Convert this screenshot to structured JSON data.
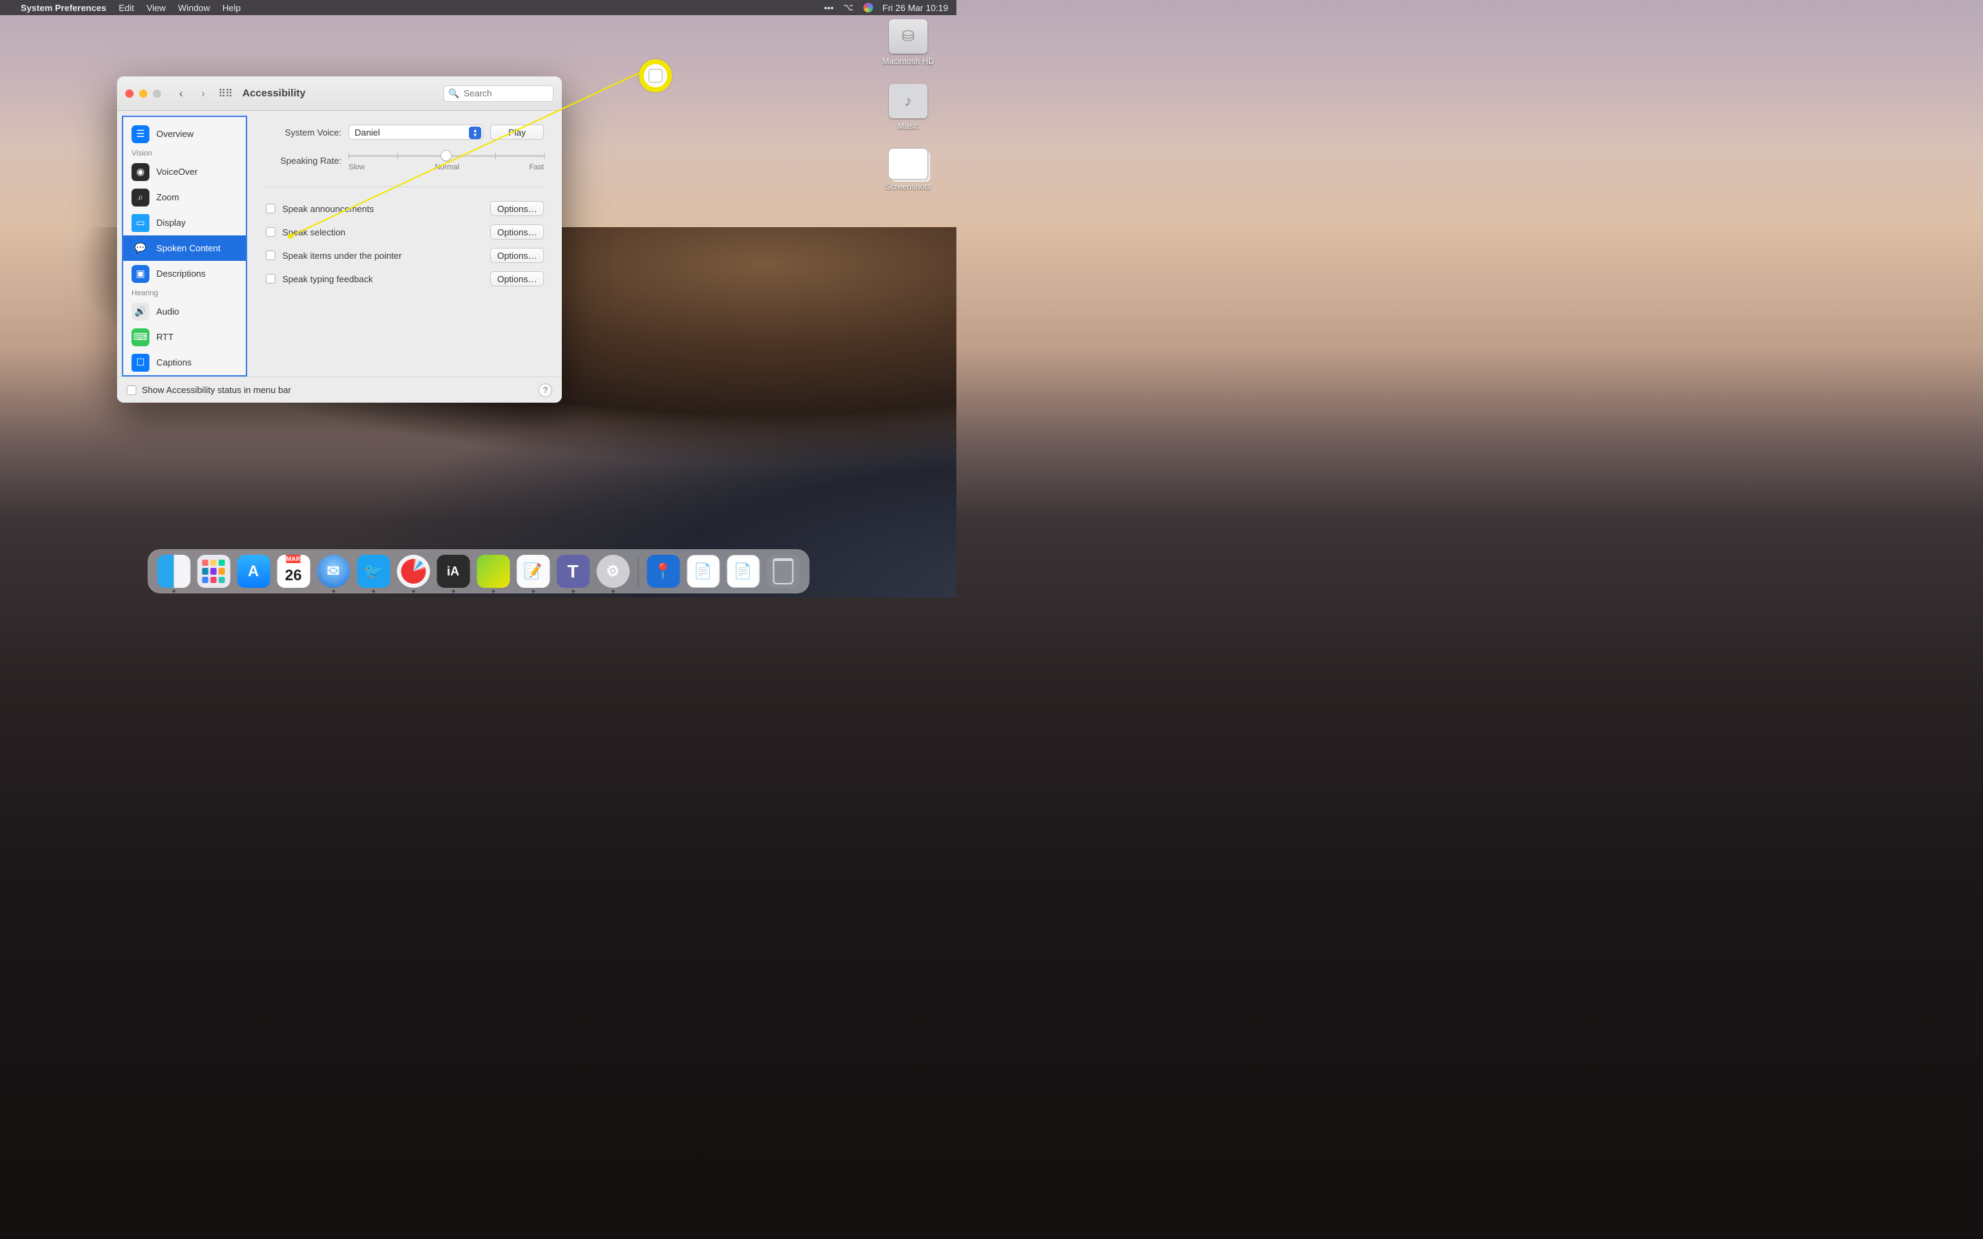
{
  "menubar": {
    "appname": "System Preferences",
    "items": [
      "Edit",
      "View",
      "Window",
      "Help"
    ],
    "datetime": "Fri 26 Mar  10:19"
  },
  "desktop": {
    "icons": [
      {
        "label": "Macintosh HD",
        "glyph": "⛁"
      },
      {
        "label": "Music",
        "glyph": "♪"
      },
      {
        "label": "Screenshots",
        "glyph": ""
      }
    ]
  },
  "window": {
    "title": "Accessibility",
    "search_placeholder": "Search",
    "sidebar": {
      "items": [
        {
          "label": "Overview"
        }
      ],
      "groups": [
        {
          "header": "Vision",
          "items": [
            {
              "label": "VoiceOver"
            },
            {
              "label": "Zoom"
            },
            {
              "label": "Display"
            },
            {
              "label": "Spoken Content",
              "selected": true
            },
            {
              "label": "Descriptions"
            }
          ]
        },
        {
          "header": "Hearing",
          "items": [
            {
              "label": "Audio"
            },
            {
              "label": "RTT"
            },
            {
              "label": "Captions"
            }
          ]
        }
      ]
    },
    "pane": {
      "system_voice_label": "System Voice:",
      "system_voice_value": "Daniel",
      "play_label": "Play",
      "speaking_rate_label": "Speaking Rate:",
      "slider_labels": {
        "slow": "Slow",
        "normal": "Normal",
        "fast": "Fast"
      },
      "options_label": "Options…",
      "checks": [
        {
          "label": "Speak announcements"
        },
        {
          "label": "Speak selection"
        },
        {
          "label": "Speak items under the pointer"
        },
        {
          "label": "Speak typing feedback"
        }
      ]
    },
    "footer": {
      "show_status_label": "Show Accessibility status in menu bar",
      "help": "?"
    }
  },
  "dock": {
    "cal_month": "MAR",
    "cal_day": "26",
    "ia": "iA",
    "teams": "T"
  }
}
